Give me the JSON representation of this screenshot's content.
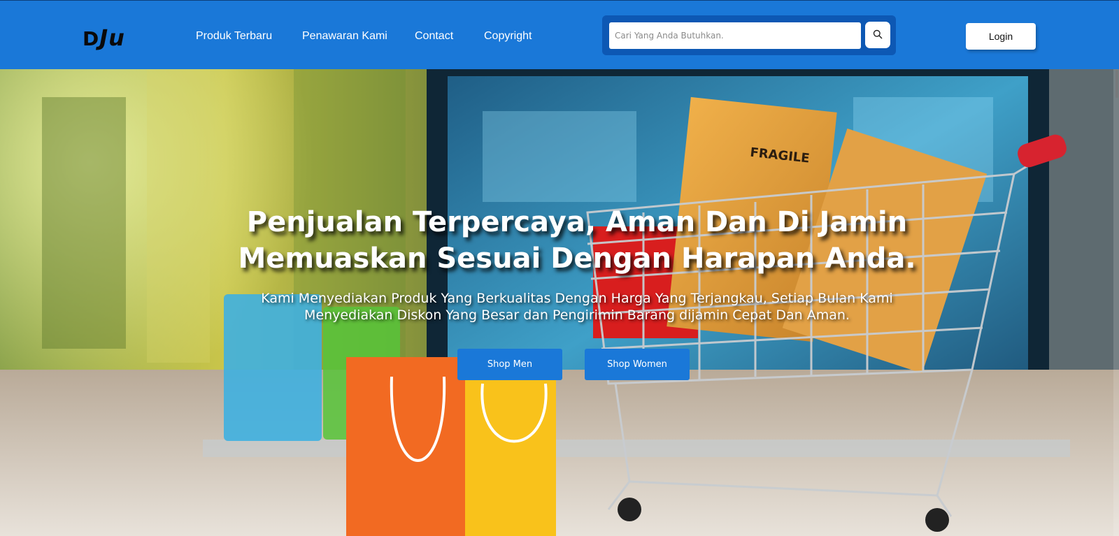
{
  "header": {
    "brand": {
      "part1": "D",
      "part2": "Ju"
    },
    "nav": [
      {
        "label": "Produk Terbaru"
      },
      {
        "label": "Penawaran Kami"
      },
      {
        "label": "Contact"
      },
      {
        "label": "Copyright"
      }
    ],
    "search": {
      "placeholder": "Cari Yang Anda Butuhkan.",
      "value": ""
    },
    "login_label": "Login"
  },
  "hero": {
    "title_line1": "Penjualan Terpercaya, Aman Dan Di Jamin",
    "title_line2": "Memuaskan Sesuai Dengan Harapan Anda.",
    "subtitle_line1": "Kami Menyediakan Produk Yang Berkualitas Dengan Harga Yang Terjangkau, Setiap Bulan Kami",
    "subtitle_line2": "Menyediakan Diskon Yang Besar dan Pengirimin Barang dijamin Cepat Dan Aman.",
    "buttons": [
      {
        "label": "Shop Men"
      },
      {
        "label": "Shop Women"
      }
    ],
    "image_box_text": "FRAGILE"
  },
  "colors": {
    "primary": "#1a78d8",
    "search_frame": "#0d58b4",
    "white": "#ffffff"
  },
  "icons": {
    "search": "search-icon"
  }
}
